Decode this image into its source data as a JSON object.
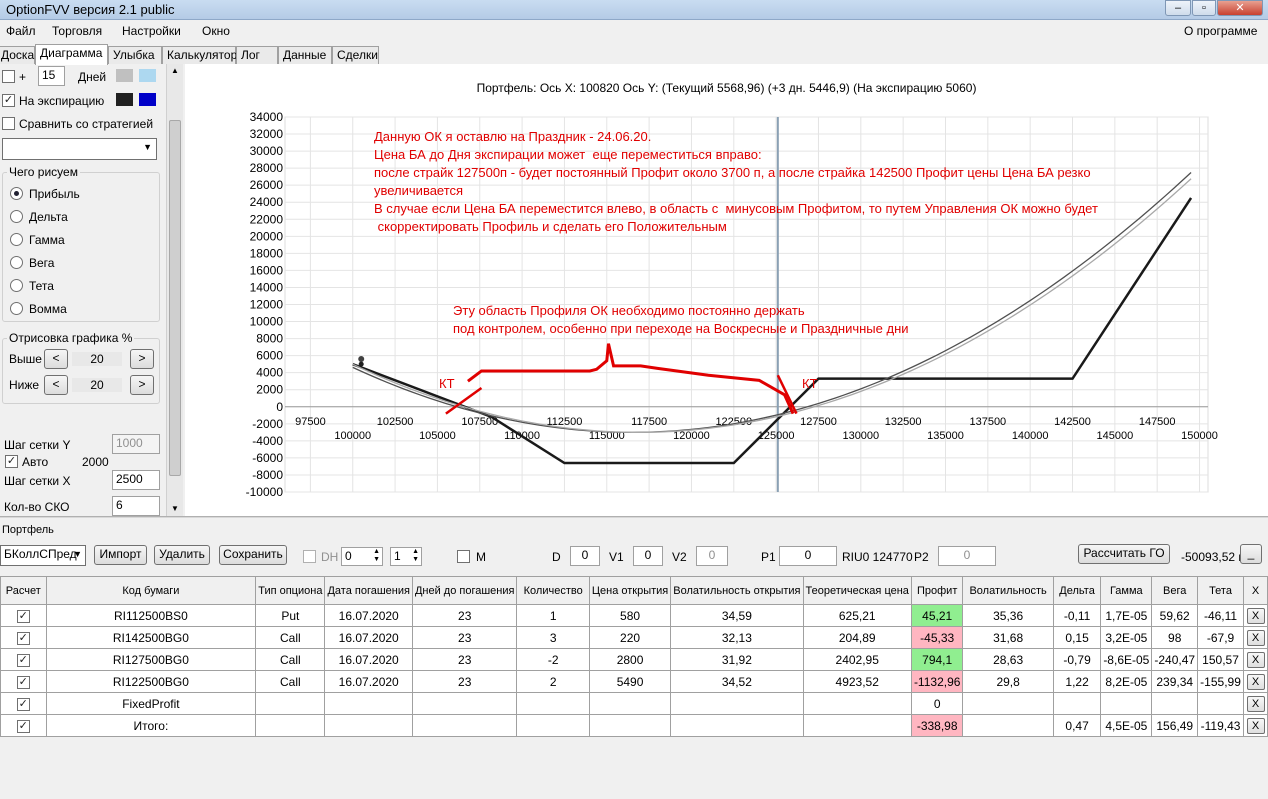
{
  "window": {
    "title": "OptionFVV версия 2.1 public"
  },
  "menu": {
    "file": "Файл",
    "trade": "Торговля",
    "settings": "Настройки",
    "window": "Окно",
    "about": "О программе"
  },
  "tabs": [
    "Доска",
    "Диаграмма",
    "Улыбка",
    "Калькулятор",
    "Лог",
    "Данные",
    "Сделки"
  ],
  "left": {
    "plus": "+",
    "days_value": "15",
    "days_label": "Дней",
    "expiry_label": "На экспирацию",
    "compare_label": "Сравнить со стратегией",
    "what_label": "Чего рисуем",
    "radios": [
      "Прибыль",
      "Дельта",
      "Гамма",
      "Вега",
      "Тета",
      "Вомма"
    ],
    "draw_label": "Отрисовка графика %",
    "above_label": "Выше",
    "above_value": "20",
    "below_label": "Ниже",
    "below_value": "20",
    "grid_y_label": "Шаг сетки Y",
    "grid_y_value": "1000",
    "auto_label": "Авто",
    "auto_value": "2000",
    "grid_x_label": "Шаг сетки X",
    "grid_x_value": "2500",
    "sko_label": "Кол-во СКО",
    "sko_value": "6",
    "btn_left": "<",
    "btn_right": ">",
    "colors": {
      "days_a": "#c0c0c0",
      "days_b": "#add8f0",
      "exp_a": "#202020",
      "exp_b": "#0000c8"
    }
  },
  "chart": {
    "header": "Портфель: Ось Х: 100820 Ось Y:  (Текущий 5568,96)  (+3 дн. 5446,9)  (На экспирацию 5060)",
    "yticks": [
      "34000",
      "32000",
      "30000",
      "28000",
      "26000",
      "24000",
      "22000",
      "20000",
      "18000",
      "16000",
      "14000",
      "12000",
      "10000",
      "8000",
      "6000",
      "4000",
      "2000",
      "0",
      "-2000",
      "-4000",
      "-6000",
      "-8000",
      "-10000"
    ],
    "xticks_top": [
      "97500",
      "102500",
      "107500",
      "112500",
      "117500",
      "122500",
      "127500",
      "132500",
      "137500",
      "142500",
      "147500"
    ],
    "xticks_bottom": [
      "100000",
      "105000",
      "110000",
      "115000",
      "120000",
      "125000",
      "130000",
      "135000",
      "140000",
      "145000",
      "150000"
    ],
    "annot1": "Данную ОК я оставлю на Праздник - 24.06.20.\nЦена БА до Дня экспирации может  еще переместиться вправо:\nпосле страйк 127500п - будет постоянный Профит около 3700 п, а после страйка 142500 Профит цены Цена БА резко\nувеличивается\nВ случае если Цена БА переместится влево, в область с  минусовым Профитом, то путем Управления ОК можно будет\n скорректировать Профиль и сделать его Положительным",
    "annot2": "Эту область Профиля ОК необходимо постоянно держать\nпод контролем, особенно при переходе на Воскресные и Праздничные дни",
    "kt1": "КТ",
    "kt2": "КТ"
  },
  "portfolio": {
    "group_label": "Портфель",
    "strategy": "БКоллСПред",
    "import": "Импорт",
    "delete": "Удалить",
    "save": "Сохранить",
    "dh": "DH",
    "dh_v1": "0",
    "dh_v2": "1",
    "m": "M",
    "d_label": "D",
    "d_value": "0",
    "v1_label": "V1",
    "v1_value": "0",
    "v2_label": "V2",
    "v2_value": "0",
    "p1_label": "P1",
    "p1_value": "0",
    "riu": "RIU0 124770",
    "p2_label": "P2",
    "p2_value": "0",
    "calc_go": "Рассчитать ГО",
    "go_value": "-50093,52 п",
    "small_btn": "_"
  },
  "table": {
    "headers": [
      "Расчет",
      "Код бумаги",
      "Тип опциона",
      "Дата погашения",
      "Дней до погашения",
      "Количество",
      "Цена открытия",
      "Волатильность открытия",
      "Теоретическая цена",
      "Профит",
      "Волатильность",
      "Дельта",
      "Гамма",
      "Вега",
      "Тета",
      "X"
    ],
    "rows": [
      {
        "code": "RI112500BS0",
        "type": "Put",
        "date": "16.07.2020",
        "days": "23",
        "qty": "1",
        "price": "580",
        "vol_open": "34,59",
        "theor": "625,21",
        "profit": "45,21",
        "pcolor": "green",
        "vol": "35,36",
        "delta": "-0,11",
        "gamma": "1,7E-05",
        "vega": "59,62",
        "theta": "-46,11",
        "x": "X"
      },
      {
        "code": "RI142500BG0",
        "type": "Call",
        "date": "16.07.2020",
        "days": "23",
        "qty": "3",
        "price": "220",
        "vol_open": "32,13",
        "theor": "204,89",
        "profit": "-45,33",
        "pcolor": "pink",
        "vol": "31,68",
        "delta": "0,15",
        "gamma": "3,2E-05",
        "vega": "98",
        "theta": "-67,9",
        "x": "X"
      },
      {
        "code": "RI127500BG0",
        "type": "Call",
        "date": "16.07.2020",
        "days": "23",
        "qty": "-2",
        "price": "2800",
        "vol_open": "31,92",
        "theor": "2402,95",
        "profit": "794,1",
        "pcolor": "green",
        "vol": "28,63",
        "delta": "-0,79",
        "gamma": "-8,6E-05",
        "vega": "-240,47",
        "theta": "150,57",
        "x": "X"
      },
      {
        "code": "RI122500BG0",
        "type": "Call",
        "date": "16.07.2020",
        "days": "23",
        "qty": "2",
        "price": "5490",
        "vol_open": "34,52",
        "theor": "4923,52",
        "profit": "-1132,96",
        "pcolor": "pink",
        "vol": "29,8",
        "delta": "1,22",
        "gamma": "8,2E-05",
        "vega": "239,34",
        "theta": "-155,99",
        "x": "X"
      },
      {
        "code": "FixedProfit",
        "type": "",
        "date": "",
        "days": "",
        "qty": "",
        "price": "",
        "vol_open": "",
        "theor": "",
        "profit": "0",
        "pcolor": "",
        "vol": "",
        "delta": "",
        "gamma": "",
        "vega": "",
        "theta": "",
        "x": "X"
      },
      {
        "code": "Итого:",
        "type": "",
        "date": "",
        "days": "",
        "qty": "",
        "price": "",
        "vol_open": "",
        "theor": "",
        "profit": "-338,98",
        "pcolor": "pink",
        "vol": "",
        "delta": "0,47",
        "gamma": "4,5E-05",
        "vega": "156,49",
        "theta": "-119,43",
        "x": "X"
      }
    ]
  }
}
